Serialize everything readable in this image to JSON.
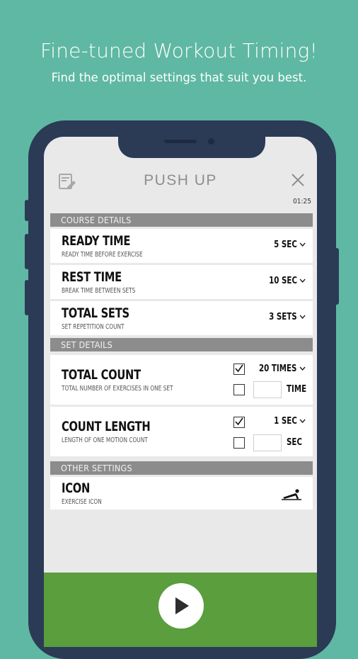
{
  "promo": {
    "headline": "Fine-tuned Workout Timing!",
    "subline": "Find the optimal settings that suit you best."
  },
  "app": {
    "title": "PUSH UP",
    "clock": "01:25",
    "left_icon": "edit-notes-icon",
    "right_icon": "close-icon"
  },
  "sections": {
    "course": "COURSE DETAILS",
    "set": "SET DETAILS",
    "other": "OTHER SETTINGS"
  },
  "course_rows": [
    {
      "title": "READY TIME",
      "desc": "READY TIME BEFORE EXERCISE",
      "value": "5 SEC"
    },
    {
      "title": "REST TIME",
      "desc": "BREAK TIME BETWEEN SETS",
      "value": "10 SEC"
    },
    {
      "title": "TOTAL SETS",
      "desc": "SET REPETITION COUNT",
      "value": "3 SETS"
    }
  ],
  "set_rows": [
    {
      "title": "TOTAL COUNT",
      "desc": "TOTAL NUMBER OF EXERCISES IN ONE SET",
      "checked_value": "20 TIMES",
      "alt_unit": "TIME"
    },
    {
      "title": "COUNT LENGTH",
      "desc": "LENGTH OF ONE MOTION COUNT",
      "checked_value": "1 SEC",
      "alt_unit": "SEC"
    }
  ],
  "other_rows": [
    {
      "title": "ICON",
      "desc": "EXERCISE ICON",
      "icon": "push-up-icon"
    }
  ],
  "colors": {
    "background": "#5fb8a3",
    "phone_frame": "#2b3a55",
    "section_header": "#8c8c8c",
    "start_bar": "#5a9e3d"
  }
}
